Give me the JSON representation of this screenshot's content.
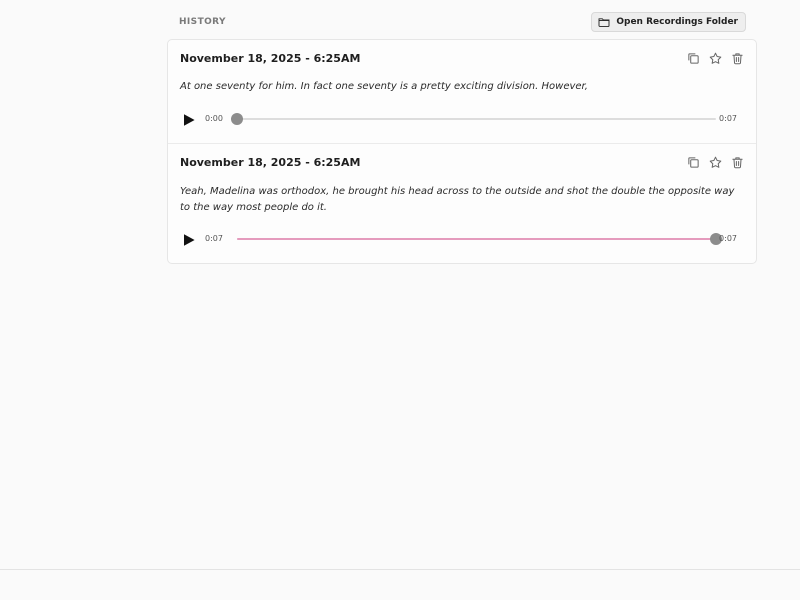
{
  "history": {
    "title": "HISTORY",
    "open_folder_button": "Open Recordings Folder",
    "entries": [
      {
        "date": "November 18, 2025 - 6:25AM",
        "text": "At one seventy for him. In fact one seventy is a pretty exciting division. However,",
        "current_time": "0:00",
        "duration": "0:07",
        "progress": 0
      },
      {
        "date": "November 18, 2025 - 6:25AM",
        "text": "Yeah, Madelina was orthodox, he brought his head across to the outside and shot the double the opposite way to the way most people do it.",
        "current_time": "0:07",
        "duration": "0:07",
        "progress": 1
      }
    ]
  },
  "icons": {
    "folder": "folder-icon",
    "copy": "copy-icon",
    "star": "star-icon",
    "trash": "trash-icon",
    "play": "play-icon"
  },
  "colors": {
    "background": "#fafafa",
    "panel_border": "#e6e6e6",
    "progress_fill": "#e59bbd",
    "thumb": "#8c8c8c",
    "track": "#dddddd"
  }
}
